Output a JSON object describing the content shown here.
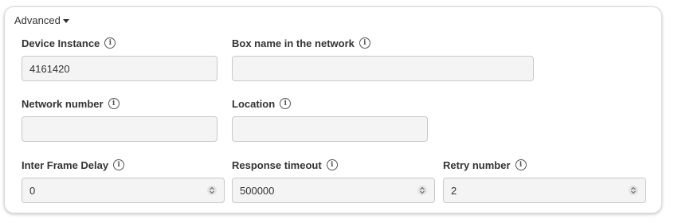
{
  "advanced": {
    "label": "Advanced"
  },
  "fields": {
    "device_instance": {
      "label": "Device Instance",
      "value": "4161420"
    },
    "box_name": {
      "label": "Box name in the network",
      "value": ""
    },
    "network_number": {
      "label": "Network number",
      "value": ""
    },
    "location": {
      "label": "Location",
      "value": ""
    },
    "inter_frame_delay": {
      "label": "Inter Frame Delay",
      "value": "0"
    },
    "response_timeout": {
      "label": "Response timeout",
      "value": "500000"
    },
    "retry_number": {
      "label": "Retry number",
      "value": "2"
    }
  },
  "icons": {
    "info": "info-icon",
    "spinner": "up-down-chevron-icon",
    "toggle": "caret-down-icon"
  }
}
